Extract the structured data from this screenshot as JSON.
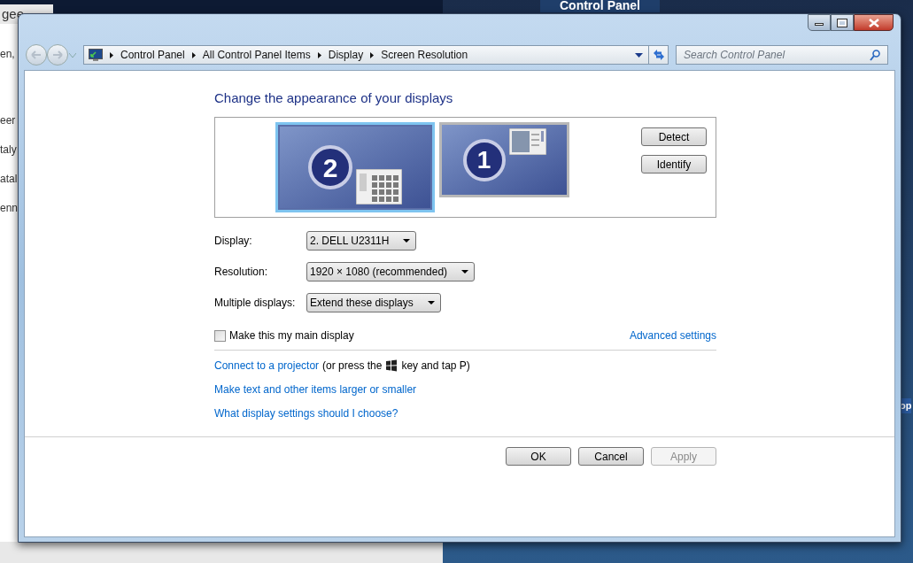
{
  "background": {
    "left_window": {
      "title": "gee",
      "lines": [
        "en,",
        "eer",
        "taly",
        "atal",
        "enn"
      ]
    },
    "right_window": {
      "title": "Control Panel",
      "side_text": "op"
    }
  },
  "address_bar": {
    "breadcrumbs": [
      "Control Panel",
      "All Control Panel Items",
      "Display",
      "Screen Resolution"
    ],
    "search": {
      "placeholder": "Search Control Panel"
    }
  },
  "heading": "Change the appearance of your displays",
  "monitors": [
    {
      "number": "2",
      "selected": true,
      "kind": "grid"
    },
    {
      "number": "1",
      "selected": false,
      "kind": "panel"
    }
  ],
  "monitor_buttons": [
    "Detect",
    "Identify"
  ],
  "settings": [
    {
      "label": "Display:",
      "value": "2. DELL U2311H"
    },
    {
      "label": "Resolution:",
      "value": "1920 × 1080 (recommended)"
    },
    {
      "label": "Multiple displays:",
      "value": "Extend these displays"
    }
  ],
  "main_display": {
    "label": "Make this my main display",
    "checked": false
  },
  "advanced_link": "Advanced settings",
  "projector": {
    "link": "Connect to a projector",
    "before": "(or press the",
    "after": "key and tap P)"
  },
  "links": [
    "Make text and other items larger or smaller",
    "What display settings should I choose?"
  ],
  "buttons": [
    {
      "label": "OK",
      "disabled": false
    },
    {
      "label": "Cancel",
      "disabled": false
    },
    {
      "label": "Apply",
      "disabled": true
    }
  ]
}
